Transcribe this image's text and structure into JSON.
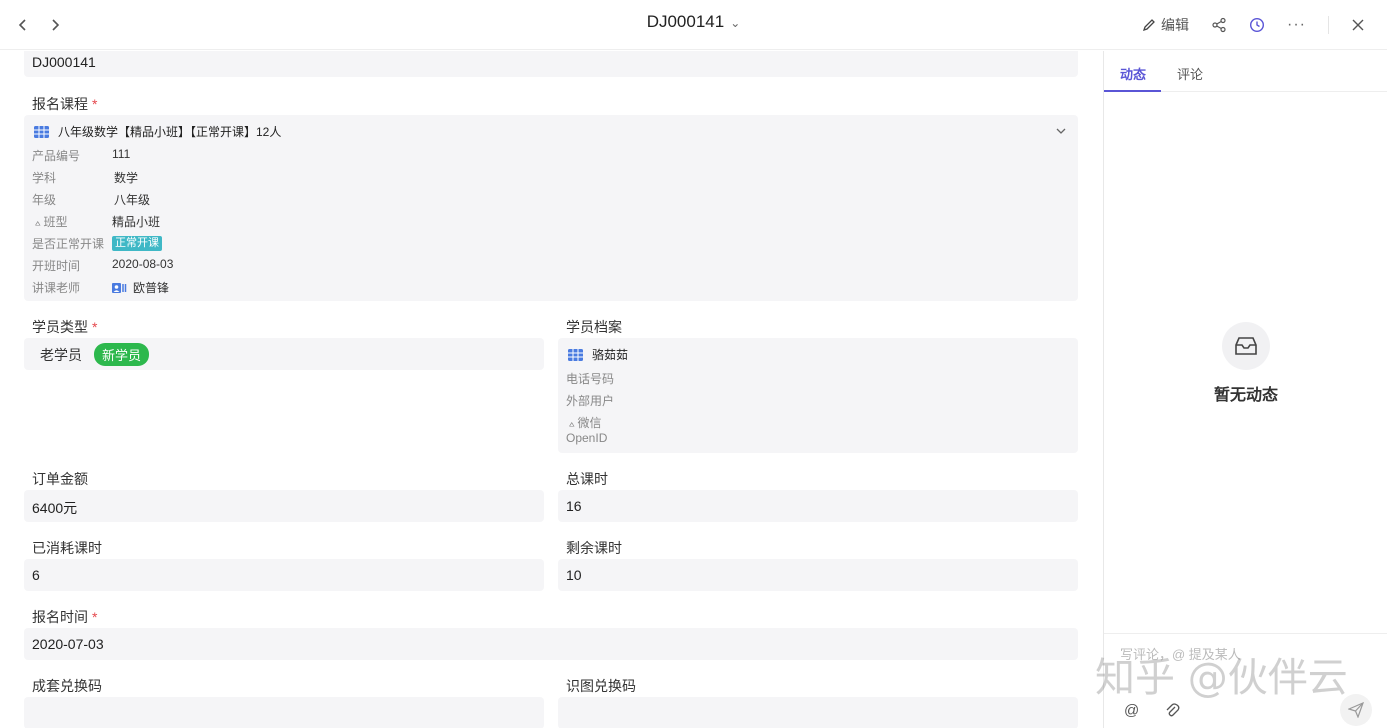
{
  "header": {
    "title": "DJ000141",
    "edit_label": "编辑"
  },
  "form": {
    "order_no": "DJ000141",
    "course": {
      "label": "报名课程",
      "name": "八年级数学【精品小班】【正常开课】12人",
      "fields": [
        {
          "label": "产品编号",
          "value": "111"
        },
        {
          "label": "学科",
          "value": "数学"
        },
        {
          "label": "年级",
          "value": "八年级"
        },
        {
          "label": "班型",
          "value": "精品小班"
        },
        {
          "label": "是否正常开课",
          "value": "正常开课"
        },
        {
          "label": "开班时间",
          "value": "2020-08-03"
        },
        {
          "label": "讲课老师",
          "value": "欧普锋"
        }
      ]
    },
    "student_type": {
      "label": "学员类型",
      "option_old": "老学员",
      "option_new": "新学员"
    },
    "student_profile": {
      "label": "学员档案",
      "name": "骆茹茹",
      "fields": [
        "电话号码",
        "外部用户",
        "微信",
        "OpenID"
      ]
    },
    "order_amount": {
      "label": "订单金额",
      "value": "6400元"
    },
    "total_hours": {
      "label": "总课时",
      "value": "16"
    },
    "used_hours": {
      "label": "已消耗课时",
      "value": "6"
    },
    "remaining_hours": {
      "label": "剩余课时",
      "value": "10"
    },
    "signup_time": {
      "label": "报名时间",
      "value": "2020-07-03"
    },
    "set_code": {
      "label": "成套兑换码",
      "value": ""
    },
    "image_code": {
      "label": "识图兑换码",
      "value": ""
    }
  },
  "side": {
    "tab_activity": "动态",
    "tab_comment": "评论",
    "empty_text": "暂无动态",
    "comment_placeholder": "写评论，@ 提及某人",
    "watermark": "知乎 @伙伴云"
  },
  "colors": {
    "accent": "#5a55d6",
    "green_tag": "#2db84d",
    "teal_tag": "#3fb8c6",
    "required": "#e5484d"
  }
}
